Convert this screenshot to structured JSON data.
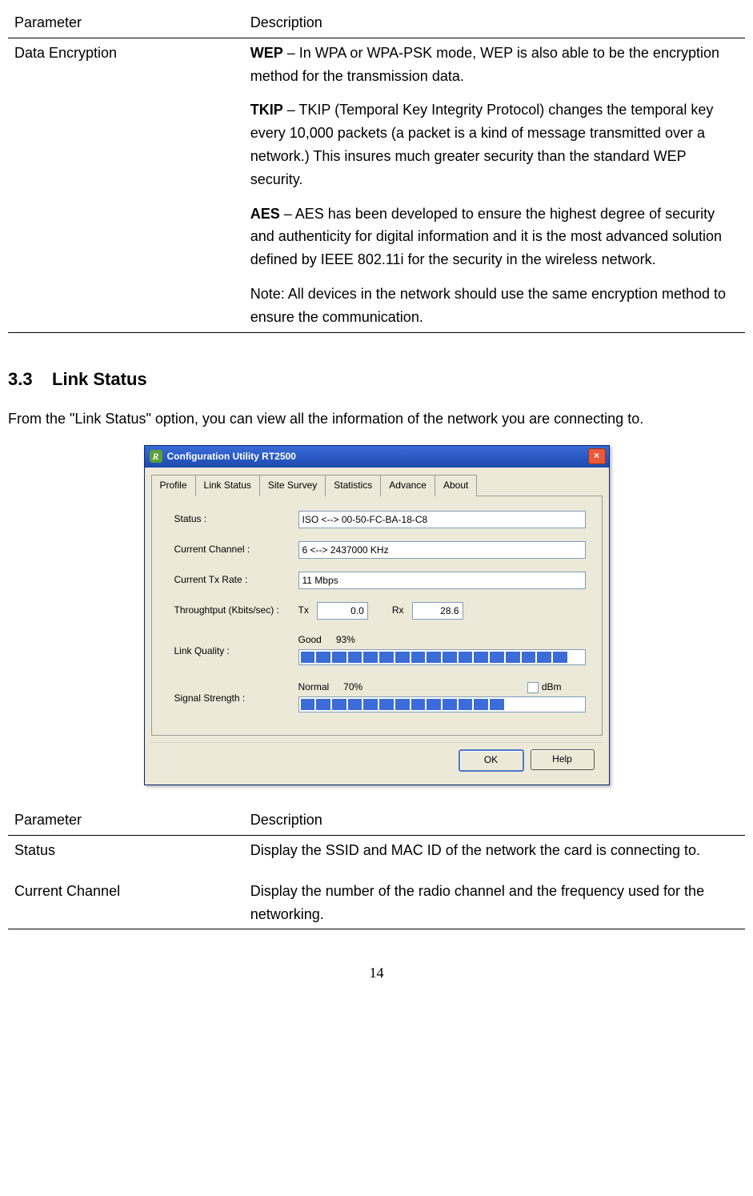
{
  "table1": {
    "header": {
      "col1": "Parameter",
      "col2": "Description"
    },
    "row": {
      "param": "Data Encryption",
      "wep_bold": "WEP",
      "wep_text": " – In WPA or WPA-PSK mode, WEP is also able to be the encryption method for the transmission data.",
      "tkip_bold": "TKIP",
      "tkip_text": " – TKIP (Temporal Key Integrity Protocol) changes the temporal key every 10,000 packets (a packet is a kind of message transmitted over a network.) This insures much greater security than the standard WEP security.",
      "aes_bold": "AES",
      "aes_text": " – AES has been developed to ensure the highest degree of security and authenticity for digital information and it is the most advanced solution defined by IEEE 802.11i for the security in the wireless network.",
      "note": "Note: All devices in the network should use the same encryption method to ensure the communication."
    }
  },
  "section": {
    "number": "3.3",
    "title": "Link Status",
    "intro": "From the \"Link Status\" option, you can view all the information of the network you are connecting to."
  },
  "dialog": {
    "title": "Configuration Utility RT2500",
    "tabs": [
      "Profile",
      "Link Status",
      "Site Survey",
      "Statistics",
      "Advance",
      "About"
    ],
    "active_tab_index": 1,
    "labels": {
      "status": "Status :",
      "channel": "Current Channel :",
      "txrate": "Current Tx Rate :",
      "throughput": "Throughtput (Kbits/sec) :",
      "linkquality": "Link Quality :",
      "signal": "Signal Strength :"
    },
    "values": {
      "status": "ISO <--> 00-50-FC-BA-18-C8",
      "channel": "6 <--> 2437000 KHz",
      "txrate": "11 Mbps",
      "tx_label": "Tx",
      "tx_val": "0.0",
      "rx_label": "Rx",
      "rx_val": "28.6",
      "lq_word": "Good",
      "lq_pct": "93%",
      "ss_word": "Normal",
      "ss_pct": "70%",
      "dbm_label": "dBm"
    },
    "buttons": {
      "ok": "OK",
      "help": "Help"
    },
    "link_quality_segments": 18,
    "link_quality_filled": 17,
    "signal_segments": 18,
    "signal_filled": 13
  },
  "table2": {
    "header": {
      "col1": "Parameter",
      "col2": "Description"
    },
    "rows": [
      {
        "param": "Status",
        "desc": "Display the SSID and MAC ID of the network the card is connecting to."
      },
      {
        "param": "Current Channel",
        "desc": "Display the number of the radio channel and the frequency used for the networking."
      }
    ]
  },
  "page_number": "14"
}
